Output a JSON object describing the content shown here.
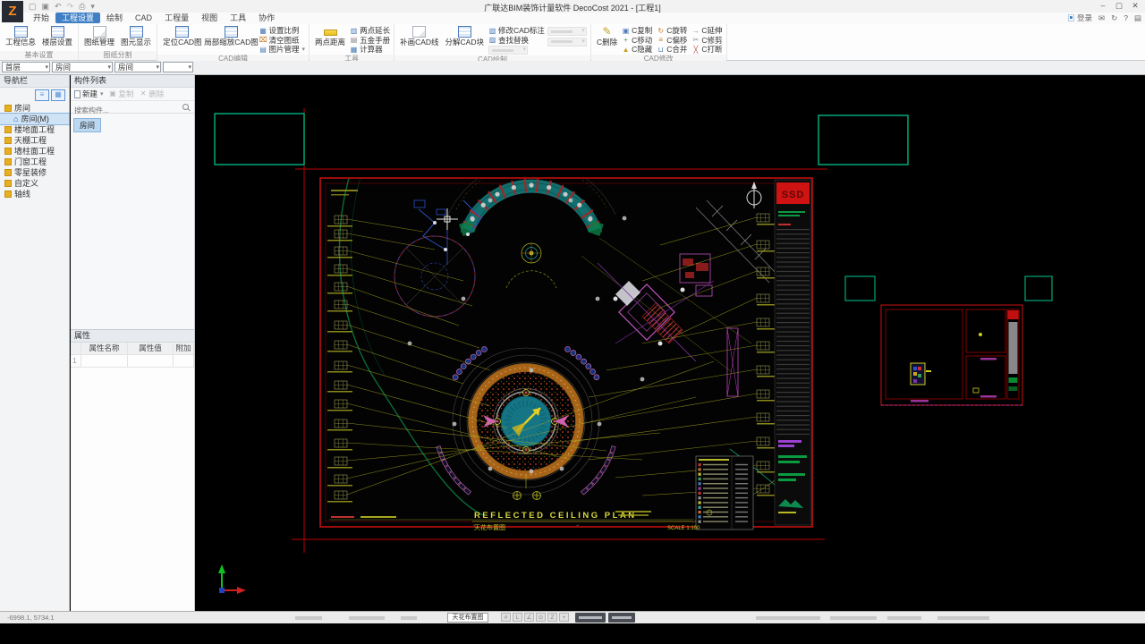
{
  "titlebar": {
    "logo_letter": "Z",
    "app_title": "广联达BIM装饰计量软件 DecoCost 2021 - [工程1]"
  },
  "window_controls": {
    "minimize": "–",
    "maximize": "▢",
    "close": "✕"
  },
  "tabs": {
    "items": [
      {
        "label": "开始"
      },
      {
        "label": "工程设置"
      },
      {
        "label": "绘制"
      },
      {
        "label": "CAD"
      },
      {
        "label": "工程量"
      },
      {
        "label": "视图"
      },
      {
        "label": "工具"
      },
      {
        "label": "协作"
      }
    ],
    "active": "工程设置"
  },
  "account": {
    "login_label": "登录"
  },
  "ribbon": {
    "groups": [
      {
        "label": "基本设置"
      },
      {
        "label": "图纸分割"
      },
      {
        "label": "CAD编辑"
      },
      {
        "label": "工具"
      },
      {
        "label": "CAD绘制"
      },
      {
        "label": "CAD修改"
      }
    ],
    "buttons": {
      "project_info": "工程信息",
      "floor_settings": "楼层设置",
      "drawing_manage": "图纸管理",
      "element_display": "图元显示",
      "locate_cad": "定位CAD图",
      "zoom_cad": "局部缩放CAD图",
      "set_scale": "设置比例",
      "clear_drawing": "清空图纸",
      "image_manage": "图片管理",
      "two_point_distance": "两点距离",
      "two_point_extend": "两点延长",
      "hardware_manual": "五金手册",
      "calculator": "计算器",
      "patch_cad_line": "补画CAD线",
      "explode_cad_block": "分解CAD块",
      "modify_cad_dim": "修改CAD标注",
      "find_replace": "查找替换",
      "c_delete": "C删除",
      "c_copy": "C复制",
      "c_rotate": "C旋转",
      "c_extend": "C延伸",
      "c_move": "C移动",
      "c_offset": "C偏移",
      "c_trim": "C修剪",
      "c_hide": "C隐藏",
      "c_merge": "C合并",
      "c_break": "C打断"
    }
  },
  "selectors": {
    "floor": "首层",
    "category": "房间",
    "component": "房间"
  },
  "nav_panel": {
    "title": "导航栏",
    "items": [
      {
        "label": "房间"
      },
      {
        "label": "房间(M)",
        "selected": true
      },
      {
        "label": "楼地面工程"
      },
      {
        "label": "天棚工程"
      },
      {
        "label": "墙柱面工程"
      },
      {
        "label": "门窗工程"
      },
      {
        "label": "零星装修"
      },
      {
        "label": "自定义"
      },
      {
        "label": "轴线"
      }
    ]
  },
  "component_panel": {
    "title": "构件列表",
    "toolbar": {
      "new": "新建",
      "copy": "复制",
      "delete": "删除"
    },
    "search_placeholder": "搜索构件...",
    "items": [
      {
        "label": "房间",
        "selected": true
      }
    ]
  },
  "properties_panel": {
    "title": "属性",
    "columns": [
      "属性名称",
      "属性值",
      "附加"
    ],
    "rows": [
      {
        "index": "1",
        "name": "",
        "value": "",
        "attach": ""
      }
    ]
  },
  "drawing": {
    "sheet_logo": "SSD",
    "title_en": "REFLECTED CEILING PLAN",
    "title_cn": "天花布置图",
    "scale_label": "SCALE  1:100"
  },
  "statusbar": {
    "coords": "-6998.1, 5734.1",
    "current_drawing": "天花布置图"
  },
  "colors": {
    "accent_blue": "#3f7fc4",
    "cad_red": "#cc1111",
    "cad_yellow": "#b8b820",
    "cad_teal": "#157a7a",
    "cad_green": "#0b6b35",
    "cad_orange": "#b06818",
    "cad_magenta": "#c050c0"
  }
}
